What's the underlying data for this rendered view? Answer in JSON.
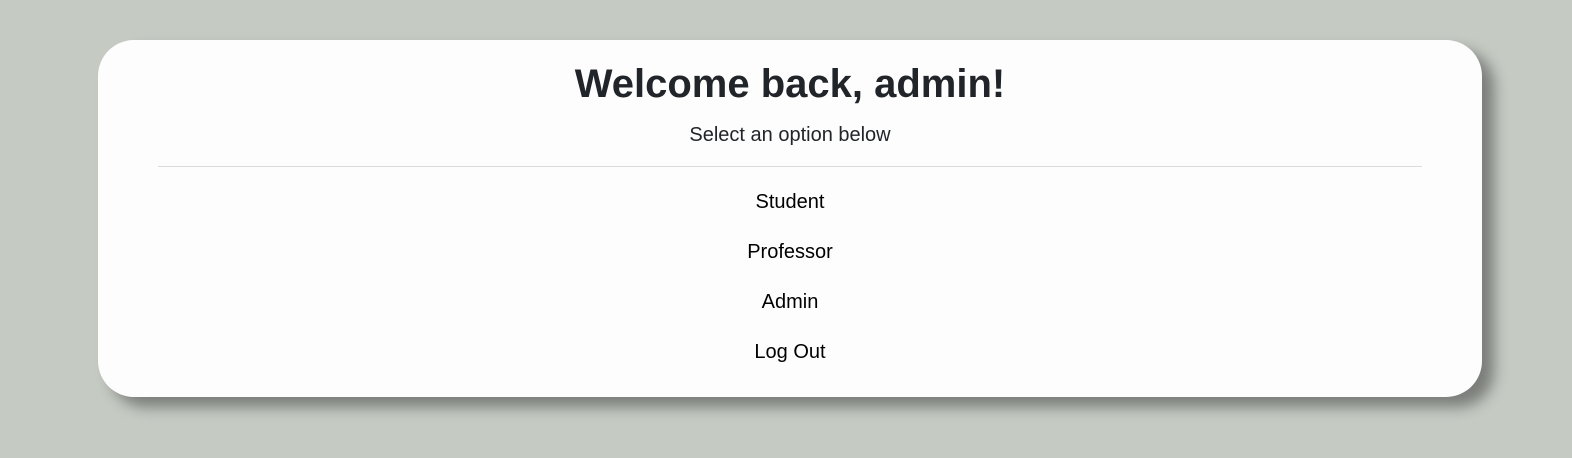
{
  "header": {
    "title": "Welcome back, admin!",
    "subtitle": "Select an option below"
  },
  "menu": {
    "items": [
      {
        "label": "Student"
      },
      {
        "label": "Professor"
      },
      {
        "label": "Admin"
      },
      {
        "label": "Log Out"
      }
    ]
  },
  "colors": {
    "page_background": "#c5cac3",
    "card_background": "#fdfdfd",
    "text": "#212529",
    "link": "#000000"
  }
}
